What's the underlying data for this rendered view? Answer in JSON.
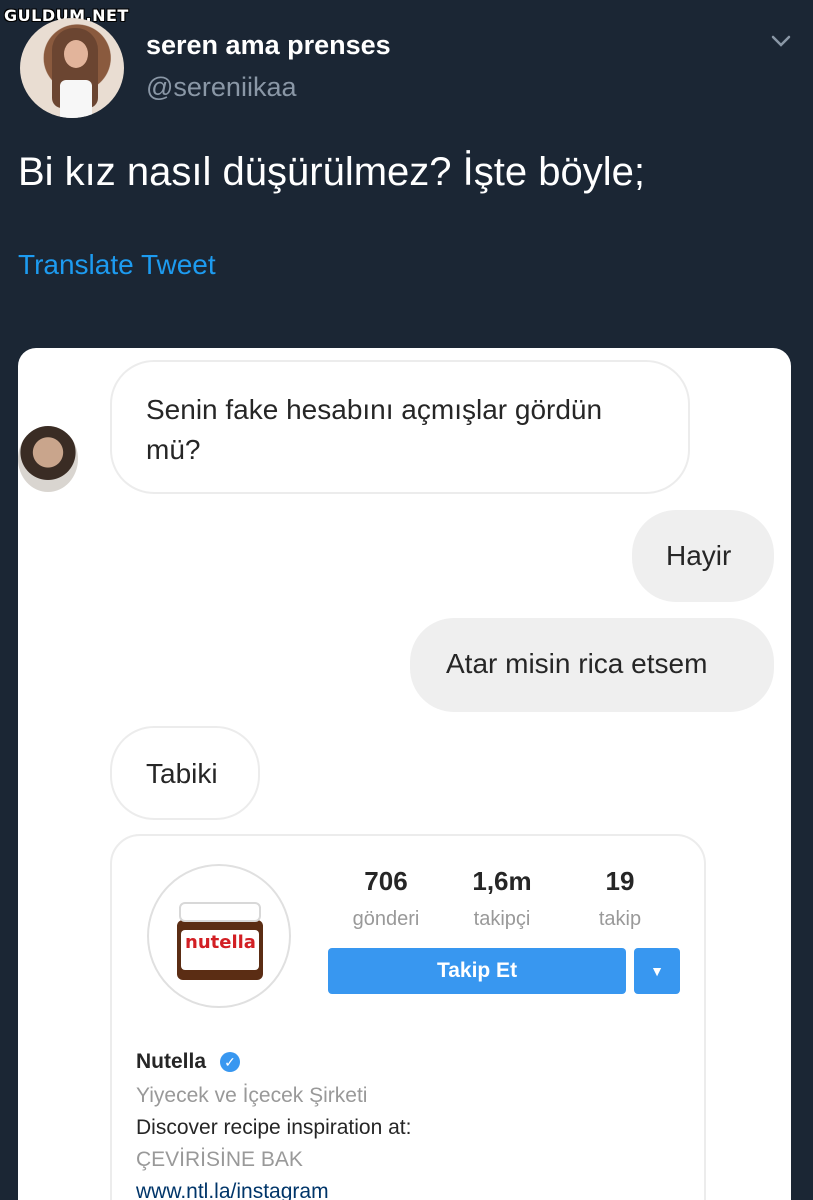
{
  "watermark": "GULDUM.NET",
  "tweet": {
    "display_name": "seren ama prenses",
    "handle": "@sereniikaa",
    "text": "Bi kız nasıl düşürülmez? İşte böyle;",
    "translate_label": "Translate Tweet"
  },
  "chat": {
    "messages": [
      {
        "direction": "in",
        "lines": [
          "Senin fake hesabını açmışlar gördün",
          "mü?"
        ]
      },
      {
        "direction": "out",
        "text": "Hayir"
      },
      {
        "direction": "out",
        "text": "Atar misin rica etsem"
      },
      {
        "direction": "in",
        "text": "Tabiki"
      }
    ]
  },
  "shared_profile": {
    "jar_brand": "nutella",
    "stats": [
      {
        "value": "706",
        "label": "gönderi"
      },
      {
        "value": "1,6m",
        "label": "takipçi"
      },
      {
        "value": "19",
        "label": "takip"
      }
    ],
    "follow_label": "Takip Et",
    "name": "Nutella",
    "category": "Yiyecek ve İçecek Şirketi",
    "bio": "Discover recipe inspiration at:",
    "translate_label": "ÇEVİRİSİNE BAK",
    "link": "www.ntl.la/instagram"
  },
  "colors": {
    "background": "#1b2634",
    "link": "#1d9bf0",
    "follow_button": "#3897f0"
  },
  "icons": [
    "chevron-down-icon",
    "verified-badge-icon",
    "dropdown-arrow-icon"
  ]
}
